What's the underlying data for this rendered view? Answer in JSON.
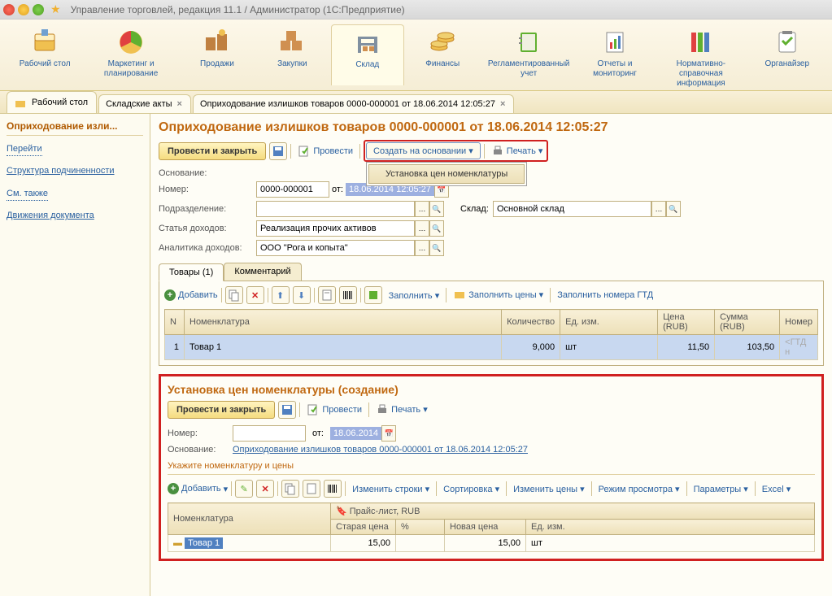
{
  "titlebar": {
    "title": "Управление торговлей, редакция 11.1 / Администратор  (1С:Предприятие)"
  },
  "toolbar": {
    "items": [
      {
        "label": "Рабочий стол"
      },
      {
        "label": "Маркетинг и планирование"
      },
      {
        "label": "Продажи"
      },
      {
        "label": "Закупки"
      },
      {
        "label": "Склад"
      },
      {
        "label": "Финансы"
      },
      {
        "label": "Регламентированный учет"
      },
      {
        "label": "Отчеты и мониторинг"
      },
      {
        "label": "Нормативно-справочная информация"
      },
      {
        "label": "Органайзер"
      }
    ]
  },
  "tabs": [
    {
      "label": "Рабочий стол"
    },
    {
      "label": "Складские акты"
    },
    {
      "label": "Оприходование излишков товаров 0000-000001 от 18.06.2014 12:05:27"
    }
  ],
  "sidebar": {
    "head": "Оприходование изли...",
    "section1": "Перейти",
    "link1": "Структура подчиненности",
    "section2": "См. также",
    "link2": "Движения документа"
  },
  "page": {
    "title": "Оприходование излишков товаров 0000-000001 от 18.06.2014 12:05:27"
  },
  "cmdbar": {
    "post_close": "Провести и закрыть",
    "post": "Провести",
    "create_based": "Создать на основании",
    "print": "Печать",
    "menu_item": "Установка цен номенклатуры"
  },
  "form": {
    "osnovanie_lbl": "Основание:",
    "nomer_lbl": "Номер:",
    "nomer": "0000-000001",
    "ot_lbl": "от:",
    "date": "18.06.2014 12:05:27",
    "podrazd_lbl": "Подразделение:",
    "sklad_lbl": "Склад:",
    "sklad": "Основной склад",
    "statya_lbl": "Статья доходов:",
    "statya": "Реализация прочих активов",
    "analit_lbl": "Аналитика доходов:",
    "analit": "ООО \"Рога и копыта\""
  },
  "inner_tabs": {
    "t1": "Товары (1)",
    "t2": "Комментарий"
  },
  "goods_bar": {
    "add": "Добавить",
    "fill": "Заполнить",
    "fill_prices": "Заполнить цены",
    "fill_gtd": "Заполнить номера ГТД"
  },
  "grid1": {
    "cols": {
      "n": "N",
      "nom": "Номенклатура",
      "qty": "Количество",
      "unit": "Ед. изм.",
      "price": "Цена (RUB)",
      "sum": "Сумма (RUB)",
      "gtd": "Номер"
    },
    "row": {
      "n": "1",
      "nom": "Товар 1",
      "qty": "9,000",
      "unit": "шт",
      "price": "11,50",
      "sum": "103,50",
      "gtd": "<ГТД н"
    }
  },
  "sub": {
    "title": "Установка цен номенклатуры (создание)",
    "post_close": "Провести и закрыть",
    "post": "Провести",
    "print": "Печать",
    "nomer_lbl": "Номер:",
    "ot_lbl": "от:",
    "date": "18.06.2014",
    "osnovanie_lbl": "Основание:",
    "osnovanie": "Оприходование излишков товаров 0000-000001 от 18.06.2014 12:05:27",
    "section_lbl": "Укажите номенклатуру и цены",
    "add": "Добавить",
    "change_lines": "Изменить строки",
    "sort": "Сортировка",
    "change_prices": "Изменить цены",
    "view_mode": "Режим просмотра",
    "params": "Параметры",
    "excel": "Excel"
  },
  "grid2": {
    "cols": {
      "nom": "Номенклатура",
      "pricelist": "Прайс-лист, RUB",
      "old": "Старая цена",
      "pct": "%",
      "new": "Новая цена",
      "unit": "Ед. изм."
    },
    "row": {
      "nom": "Товар 1",
      "old": "15,00",
      "pct": "",
      "new": "15,00",
      "unit": "шт"
    }
  }
}
